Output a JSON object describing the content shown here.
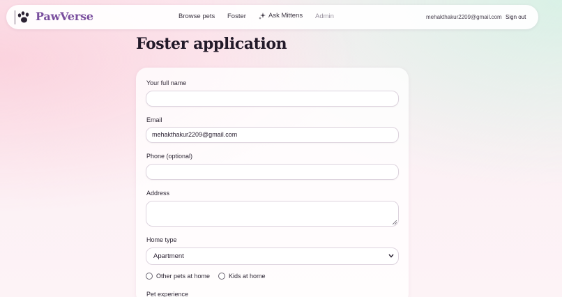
{
  "nav": {
    "brand": "PawVerse",
    "links": {
      "browse": "Browse pets",
      "foster": "Foster",
      "ask": "Ask Mittens",
      "admin": "Admin"
    },
    "email": "mehakthakur2209@gmail.com",
    "sign_out": "Sign out"
  },
  "page": {
    "title": "Foster application"
  },
  "form": {
    "full_name": {
      "label": "Your full name",
      "value": ""
    },
    "email": {
      "label": "Email",
      "value": "mehakthakur2209@gmail.com"
    },
    "phone": {
      "label": "Phone (optional)",
      "value": ""
    },
    "address": {
      "label": "Address",
      "value": ""
    },
    "home_type": {
      "label": "Home type",
      "selected": "Apartment"
    },
    "other_pets": {
      "label": "Other pets at home",
      "checked": false
    },
    "kids": {
      "label": "Kids at home",
      "checked": false
    },
    "pet_experience": {
      "label": "Pet experience"
    }
  },
  "colors": {
    "brand": "#7a4f9e"
  }
}
